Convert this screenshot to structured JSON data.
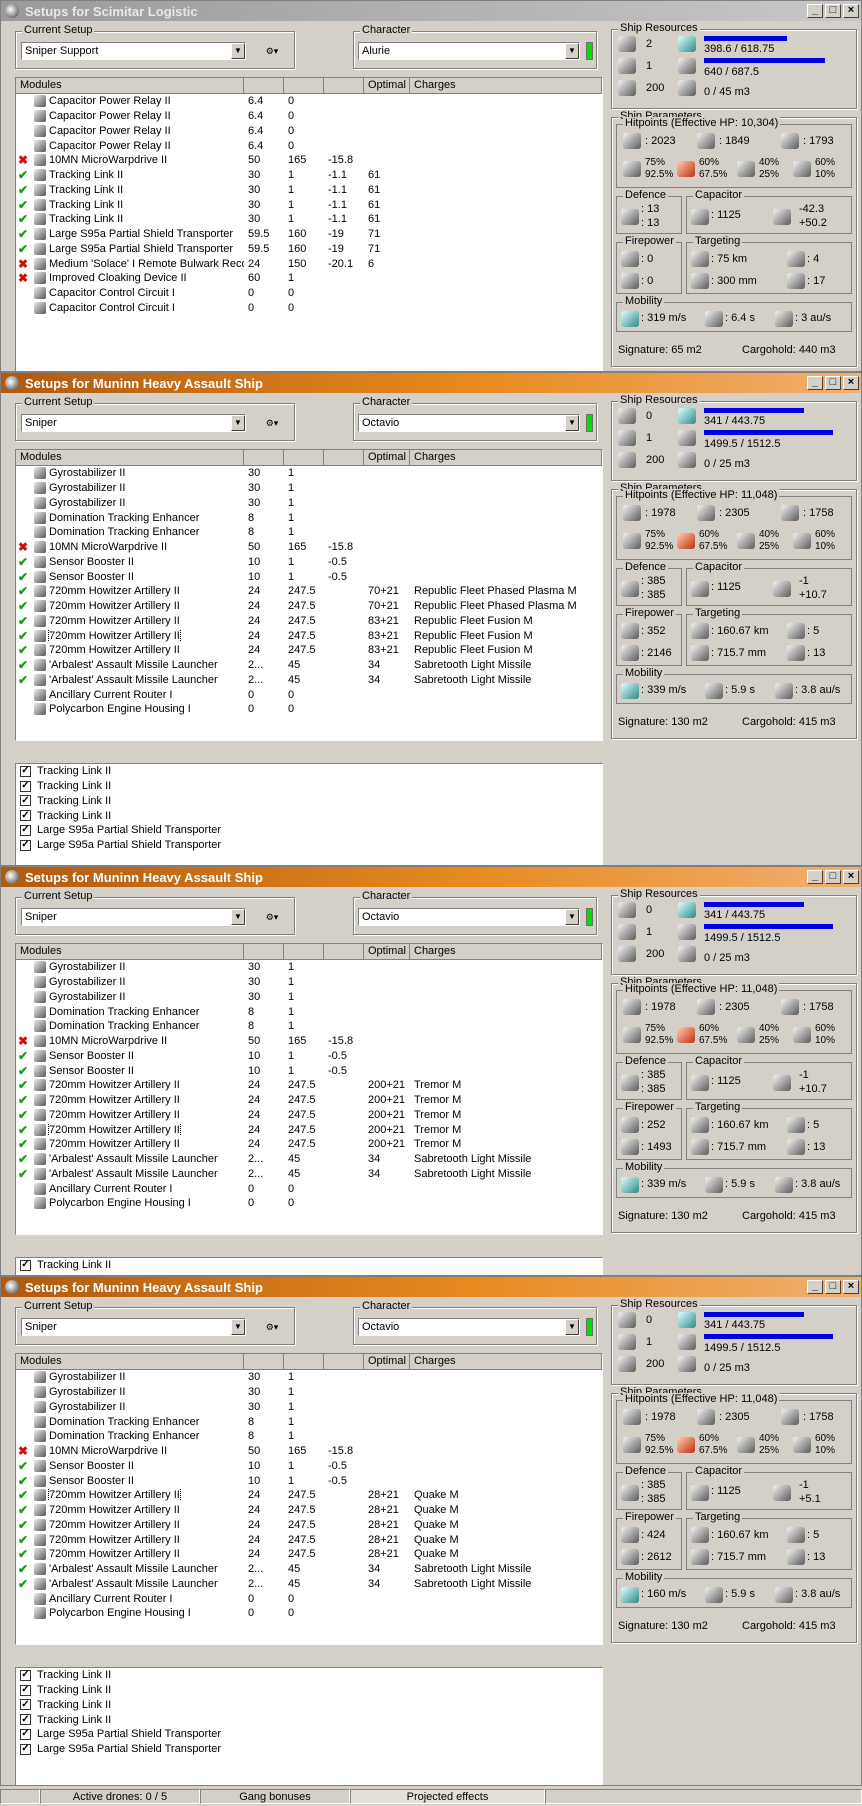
{
  "windows": [
    {
      "title": "Setups for Scimitar Logistic",
      "title_style": "inactive",
      "setup": "Sniper Support",
      "character": "Alurie",
      "headers": [
        "Modules",
        "",
        "",
        "",
        "Optimal",
        "Charges"
      ],
      "modules": [
        {
          "st": "",
          "name": "Capacitor Power Relay II",
          "c1": "6.4",
          "c2": "0",
          "c3": "",
          "opt": "",
          "chg": ""
        },
        {
          "st": "",
          "name": "Capacitor Power Relay II",
          "c1": "6.4",
          "c2": "0",
          "c3": "",
          "opt": "",
          "chg": ""
        },
        {
          "st": "",
          "name": "Capacitor Power Relay II",
          "c1": "6.4",
          "c2": "0",
          "c3": "",
          "opt": "",
          "chg": ""
        },
        {
          "st": "",
          "name": "Capacitor Power Relay II",
          "c1": "6.4",
          "c2": "0",
          "c3": "",
          "opt": "",
          "chg": ""
        },
        {
          "st": "x",
          "name": "10MN MicroWarpdrive II",
          "c1": "50",
          "c2": "165",
          "c3": "-15.8",
          "opt": "",
          "chg": ""
        },
        {
          "st": "v",
          "name": "Tracking Link II",
          "c1": "30",
          "c2": "1",
          "c3": "-1.1",
          "opt": "61",
          "chg": ""
        },
        {
          "st": "v",
          "name": "Tracking Link II",
          "c1": "30",
          "c2": "1",
          "c3": "-1.1",
          "opt": "61",
          "chg": ""
        },
        {
          "st": "v",
          "name": "Tracking Link II",
          "c1": "30",
          "c2": "1",
          "c3": "-1.1",
          "opt": "61",
          "chg": ""
        },
        {
          "st": "v",
          "name": "Tracking Link II",
          "c1": "30",
          "c2": "1",
          "c3": "-1.1",
          "opt": "61",
          "chg": ""
        },
        {
          "st": "v",
          "name": "Large S95a Partial Shield Transporter",
          "c1": "59.5",
          "c2": "160",
          "c3": "-19",
          "opt": "71",
          "chg": ""
        },
        {
          "st": "v",
          "name": "Large S95a Partial Shield Transporter",
          "c1": "59.5",
          "c2": "160",
          "c3": "-19",
          "opt": "71",
          "chg": ""
        },
        {
          "st": "x",
          "name": "Medium 'Solace' I Remote Bulwark Reco...",
          "c1": "24",
          "c2": "150",
          "c3": "-20.1",
          "opt": "6",
          "chg": ""
        },
        {
          "st": "x",
          "name": "Improved Cloaking Device II",
          "c1": "60",
          "c2": "1",
          "c3": "",
          "opt": "",
          "chg": ""
        },
        {
          "st": "",
          "name": "Capacitor Control Circuit I",
          "c1": "0",
          "c2": "0",
          "c3": "",
          "opt": "",
          "chg": ""
        },
        {
          "st": "",
          "name": "Capacitor Control Circuit I",
          "c1": "0",
          "c2": "0",
          "c3": "",
          "opt": "",
          "chg": ""
        }
      ],
      "projected": [],
      "res": {
        "hi": "2",
        "mid": "1",
        "drone": "200",
        "cpu": "398.6 / 618.75",
        "pg": "640 / 687.5",
        "db": "0 / 45 m3",
        "cpu_frac": 0.64,
        "pg_frac": 0.93,
        "db_frac": 0
      },
      "hp": {
        "header": "Hitpoints (Effective HP: 10,304)",
        "shield": ": 2023",
        "armor": ": 1849",
        "hull": ": 1793",
        "r1a": "75%",
        "r1b": "92.5%",
        "r2a": "60%",
        "r2b": "67.5%",
        "r3a": "40%",
        "r3b": "25%",
        "r4a": "60%",
        "r4b": "10%"
      },
      "def": {
        "a": ": 13",
        "b": ": 13"
      },
      "cap": {
        "a": ": 1125",
        "b": "-42.3",
        "c": "+50.2"
      },
      "fire": {
        "a": ": 0",
        "b": ": 0"
      },
      "tgt": {
        "a": ": 75 km",
        "b": ": 4",
        "c": ": 300 mm",
        "d": ": 17"
      },
      "mob": {
        "a": ": 319 m/s",
        "b": ": 6.4 s",
        "c": ": 3 au/s"
      },
      "sig": "Signature: 65 m2",
      "cargo": "Cargohold: 440 m3"
    },
    {
      "title": "Setups for Muninn Heavy Assault Ship",
      "title_style": "active",
      "setup": "Sniper",
      "character": "Octavio",
      "headers": [
        "Modules",
        "",
        "",
        "",
        "Optimal",
        "Charges"
      ],
      "modules": [
        {
          "st": "",
          "name": "Gyrostabilizer II",
          "c1": "30",
          "c2": "1",
          "c3": "",
          "opt": "",
          "chg": ""
        },
        {
          "st": "",
          "name": "Gyrostabilizer II",
          "c1": "30",
          "c2": "1",
          "c3": "",
          "opt": "",
          "chg": ""
        },
        {
          "st": "",
          "name": "Gyrostabilizer II",
          "c1": "30",
          "c2": "1",
          "c3": "",
          "opt": "",
          "chg": ""
        },
        {
          "st": "",
          "name": "Domination Tracking Enhancer",
          "c1": "8",
          "c2": "1",
          "c3": "",
          "opt": "",
          "chg": ""
        },
        {
          "st": "",
          "name": "Domination Tracking Enhancer",
          "c1": "8",
          "c2": "1",
          "c3": "",
          "opt": "",
          "chg": ""
        },
        {
          "st": "x",
          "name": "10MN MicroWarpdrive II",
          "c1": "50",
          "c2": "165",
          "c3": "-15.8",
          "opt": "",
          "chg": ""
        },
        {
          "st": "v",
          "name": "Sensor Booster II",
          "c1": "10",
          "c2": "1",
          "c3": "-0.5",
          "opt": "",
          "chg": ""
        },
        {
          "st": "v",
          "name": "Sensor Booster II",
          "c1": "10",
          "c2": "1",
          "c3": "-0.5",
          "opt": "",
          "chg": ""
        },
        {
          "st": "v",
          "name": "720mm Howitzer Artillery II",
          "c1": "24",
          "c2": "247.5",
          "c3": "",
          "opt": "70+21",
          "chg": "Republic Fleet Phased Plasma M"
        },
        {
          "st": "v",
          "name": "720mm Howitzer Artillery II",
          "c1": "24",
          "c2": "247.5",
          "c3": "",
          "opt": "70+21",
          "chg": "Republic Fleet Phased Plasma M"
        },
        {
          "st": "v",
          "name": "720mm Howitzer Artillery II",
          "c1": "24",
          "c2": "247.5",
          "c3": "",
          "opt": "83+21",
          "chg": "Republic Fleet Fusion M"
        },
        {
          "st": "v",
          "name": "720mm Howitzer Artillery II",
          "c1": "24",
          "c2": "247.5",
          "c3": "",
          "opt": "83+21",
          "chg": "Republic Fleet Fusion M",
          "sel": true
        },
        {
          "st": "v",
          "name": "720mm Howitzer Artillery II",
          "c1": "24",
          "c2": "247.5",
          "c3": "",
          "opt": "83+21",
          "chg": "Republic Fleet Fusion M"
        },
        {
          "st": "v",
          "name": "'Arbalest' Assault Missile Launcher",
          "c1": "2...",
          "c2": "45",
          "c3": "",
          "opt": "34",
          "chg": "Sabretooth Light Missile"
        },
        {
          "st": "v",
          "name": "'Arbalest' Assault Missile Launcher",
          "c1": "2...",
          "c2": "45",
          "c3": "",
          "opt": "34",
          "chg": "Sabretooth Light Missile"
        },
        {
          "st": "",
          "name": "Ancillary Current Router I",
          "c1": "0",
          "c2": "0",
          "c3": "",
          "opt": "",
          "chg": ""
        },
        {
          "st": "",
          "name": "Polycarbon Engine Housing I",
          "c1": "0",
          "c2": "0",
          "c3": "",
          "opt": "",
          "chg": ""
        }
      ],
      "projected": [
        "Tracking Link II",
        "Tracking Link II",
        "Tracking Link II",
        "Tracking Link II",
        "Large S95a Partial Shield Transporter",
        "Large S95a Partial Shield Transporter"
      ],
      "res": {
        "hi": "0",
        "mid": "1",
        "drone": "200",
        "cpu": "341 / 443.75",
        "pg": "1499.5 / 1512.5",
        "db": "0 / 25 m3",
        "cpu_frac": 0.77,
        "pg_frac": 0.99,
        "db_frac": 0
      },
      "hp": {
        "header": "Hitpoints (Effective HP: 11,048)",
        "shield": ": 1978",
        "armor": ": 2305",
        "hull": ": 1758",
        "r1a": "75%",
        "r1b": "92.5%",
        "r2a": "60%",
        "r2b": "67.5%",
        "r3a": "40%",
        "r3b": "25%",
        "r4a": "60%",
        "r4b": "10%"
      },
      "def": {
        "a": ": 385",
        "b": ": 385"
      },
      "cap": {
        "a": ": 1125",
        "b": "-1",
        "c": "+10.7"
      },
      "fire": {
        "a": ": 352",
        "b": ": 2146"
      },
      "tgt": {
        "a": ": 160.67 km",
        "b": ": 5",
        "c": ": 715.7 mm",
        "d": ": 13"
      },
      "mob": {
        "a": ": 339 m/s",
        "b": ": 5.9 s",
        "c": ": 3.8 au/s"
      },
      "sig": "Signature: 130 m2",
      "cargo": "Cargohold: 415 m3"
    },
    {
      "title": "Setups for Muninn Heavy Assault Ship",
      "title_style": "active",
      "setup": "Sniper",
      "character": "Octavio",
      "headers": [
        "Modules",
        "",
        "",
        "",
        "Optimal",
        "Charges"
      ],
      "modules": [
        {
          "st": "",
          "name": "Gyrostabilizer II",
          "c1": "30",
          "c2": "1",
          "c3": "",
          "opt": "",
          "chg": ""
        },
        {
          "st": "",
          "name": "Gyrostabilizer II",
          "c1": "30",
          "c2": "1",
          "c3": "",
          "opt": "",
          "chg": ""
        },
        {
          "st": "",
          "name": "Gyrostabilizer II",
          "c1": "30",
          "c2": "1",
          "c3": "",
          "opt": "",
          "chg": ""
        },
        {
          "st": "",
          "name": "Domination Tracking Enhancer",
          "c1": "8",
          "c2": "1",
          "c3": "",
          "opt": "",
          "chg": ""
        },
        {
          "st": "",
          "name": "Domination Tracking Enhancer",
          "c1": "8",
          "c2": "1",
          "c3": "",
          "opt": "",
          "chg": ""
        },
        {
          "st": "x",
          "name": "10MN MicroWarpdrive II",
          "c1": "50",
          "c2": "165",
          "c3": "-15.8",
          "opt": "",
          "chg": ""
        },
        {
          "st": "v",
          "name": "Sensor Booster II",
          "c1": "10",
          "c2": "1",
          "c3": "-0.5",
          "opt": "",
          "chg": ""
        },
        {
          "st": "v",
          "name": "Sensor Booster II",
          "c1": "10",
          "c2": "1",
          "c3": "-0.5",
          "opt": "",
          "chg": ""
        },
        {
          "st": "v",
          "name": "720mm Howitzer Artillery II",
          "c1": "24",
          "c2": "247.5",
          "c3": "",
          "opt": "200+21",
          "chg": "Tremor M"
        },
        {
          "st": "v",
          "name": "720mm Howitzer Artillery II",
          "c1": "24",
          "c2": "247.5",
          "c3": "",
          "opt": "200+21",
          "chg": "Tremor M"
        },
        {
          "st": "v",
          "name": "720mm Howitzer Artillery II",
          "c1": "24",
          "c2": "247.5",
          "c3": "",
          "opt": "200+21",
          "chg": "Tremor M"
        },
        {
          "st": "v",
          "name": "720mm Howitzer Artillery II",
          "c1": "24",
          "c2": "247.5",
          "c3": "",
          "opt": "200+21",
          "chg": "Tremor M",
          "sel": true
        },
        {
          "st": "v",
          "name": "720mm Howitzer Artillery II",
          "c1": "24",
          "c2": "247.5",
          "c3": "",
          "opt": "200+21",
          "chg": "Tremor M"
        },
        {
          "st": "v",
          "name": "'Arbalest' Assault Missile Launcher",
          "c1": "2...",
          "c2": "45",
          "c3": "",
          "opt": "34",
          "chg": "Sabretooth Light Missile"
        },
        {
          "st": "v",
          "name": "'Arbalest' Assault Missile Launcher",
          "c1": "2...",
          "c2": "45",
          "c3": "",
          "opt": "34",
          "chg": "Sabretooth Light Missile"
        },
        {
          "st": "",
          "name": "Ancillary Current Router I",
          "c1": "0",
          "c2": "0",
          "c3": "",
          "opt": "",
          "chg": ""
        },
        {
          "st": "",
          "name": "Polycarbon Engine Housing I",
          "c1": "0",
          "c2": "0",
          "c3": "",
          "opt": "",
          "chg": ""
        }
      ],
      "projected": [
        "Tracking Link II"
      ],
      "res": {
        "hi": "0",
        "mid": "1",
        "drone": "200",
        "cpu": "341 / 443.75",
        "pg": "1499.5 / 1512.5",
        "db": "0 / 25 m3",
        "cpu_frac": 0.77,
        "pg_frac": 0.99,
        "db_frac": 0
      },
      "hp": {
        "header": "Hitpoints (Effective HP: 11,048)",
        "shield": ": 1978",
        "armor": ": 2305",
        "hull": ": 1758",
        "r1a": "75%",
        "r1b": "92.5%",
        "r2a": "60%",
        "r2b": "67.5%",
        "r3a": "40%",
        "r3b": "25%",
        "r4a": "60%",
        "r4b": "10%"
      },
      "def": {
        "a": ": 385",
        "b": ": 385"
      },
      "cap": {
        "a": ": 1125",
        "b": "-1",
        "c": "+10.7"
      },
      "fire": {
        "a": ": 252",
        "b": ": 1493"
      },
      "tgt": {
        "a": ": 160.67 km",
        "b": ": 5",
        "c": ": 715.7 mm",
        "d": ": 13"
      },
      "mob": {
        "a": ": 339 m/s",
        "b": ": 5.9 s",
        "c": ": 3.8 au/s"
      },
      "sig": "Signature: 130 m2",
      "cargo": "Cargohold: 415 m3"
    },
    {
      "title": "Setups for Muninn Heavy Assault Ship",
      "title_style": "active",
      "setup": "Sniper",
      "character": "Octavio",
      "headers": [
        "Modules",
        "",
        "",
        "",
        "Optimal",
        "Charges"
      ],
      "modules": [
        {
          "st": "",
          "name": "Gyrostabilizer II",
          "c1": "30",
          "c2": "1",
          "c3": "",
          "opt": "",
          "chg": ""
        },
        {
          "st": "",
          "name": "Gyrostabilizer II",
          "c1": "30",
          "c2": "1",
          "c3": "",
          "opt": "",
          "chg": ""
        },
        {
          "st": "",
          "name": "Gyrostabilizer II",
          "c1": "30",
          "c2": "1",
          "c3": "",
          "opt": "",
          "chg": ""
        },
        {
          "st": "",
          "name": "Domination Tracking Enhancer",
          "c1": "8",
          "c2": "1",
          "c3": "",
          "opt": "",
          "chg": ""
        },
        {
          "st": "",
          "name": "Domination Tracking Enhancer",
          "c1": "8",
          "c2": "1",
          "c3": "",
          "opt": "",
          "chg": ""
        },
        {
          "st": "x",
          "name": "10MN MicroWarpdrive II",
          "c1": "50",
          "c2": "165",
          "c3": "-15.8",
          "opt": "",
          "chg": ""
        },
        {
          "st": "v",
          "name": "Sensor Booster II",
          "c1": "10",
          "c2": "1",
          "c3": "-0.5",
          "opt": "",
          "chg": ""
        },
        {
          "st": "v",
          "name": "Sensor Booster II",
          "c1": "10",
          "c2": "1",
          "c3": "-0.5",
          "opt": "",
          "chg": ""
        },
        {
          "st": "v",
          "name": "720mm Howitzer Artillery II",
          "c1": "24",
          "c2": "247.5",
          "c3": "",
          "opt": "28+21",
          "chg": "Quake M",
          "sel": true
        },
        {
          "st": "v",
          "name": "720mm Howitzer Artillery II",
          "c1": "24",
          "c2": "247.5",
          "c3": "",
          "opt": "28+21",
          "chg": "Quake M"
        },
        {
          "st": "v",
          "name": "720mm Howitzer Artillery II",
          "c1": "24",
          "c2": "247.5",
          "c3": "",
          "opt": "28+21",
          "chg": "Quake M"
        },
        {
          "st": "v",
          "name": "720mm Howitzer Artillery II",
          "c1": "24",
          "c2": "247.5",
          "c3": "",
          "opt": "28+21",
          "chg": "Quake M"
        },
        {
          "st": "v",
          "name": "720mm Howitzer Artillery II",
          "c1": "24",
          "c2": "247.5",
          "c3": "",
          "opt": "28+21",
          "chg": "Quake M"
        },
        {
          "st": "v",
          "name": "'Arbalest' Assault Missile Launcher",
          "c1": "2...",
          "c2": "45",
          "c3": "",
          "opt": "34",
          "chg": "Sabretooth Light Missile"
        },
        {
          "st": "v",
          "name": "'Arbalest' Assault Missile Launcher",
          "c1": "2...",
          "c2": "45",
          "c3": "",
          "opt": "34",
          "chg": "Sabretooth Light Missile"
        },
        {
          "st": "",
          "name": "Ancillary Current Router I",
          "c1": "0",
          "c2": "0",
          "c3": "",
          "opt": "",
          "chg": ""
        },
        {
          "st": "",
          "name": "Polycarbon Engine Housing I",
          "c1": "0",
          "c2": "0",
          "c3": "",
          "opt": "",
          "chg": ""
        }
      ],
      "projected": [
        "Tracking Link II",
        "Tracking Link II",
        "Tracking Link II",
        "Tracking Link II",
        "Large S95a Partial Shield Transporter",
        "Large S95a Partial Shield Transporter"
      ],
      "res": {
        "hi": "0",
        "mid": "1",
        "drone": "200",
        "cpu": "341 / 443.75",
        "pg": "1499.5 / 1512.5",
        "db": "0 / 25 m3",
        "cpu_frac": 0.77,
        "pg_frac": 0.99,
        "db_frac": 0
      },
      "hp": {
        "header": "Hitpoints (Effective HP: 11,048)",
        "shield": ": 1978",
        "armor": ": 2305",
        "hull": ": 1758",
        "r1a": "75%",
        "r1b": "92.5%",
        "r2a": "60%",
        "r2b": "67.5%",
        "r3a": "40%",
        "r3b": "25%",
        "r4a": "60%",
        "r4b": "10%"
      },
      "def": {
        "a": ": 385",
        "b": ": 385"
      },
      "cap": {
        "a": ": 1125",
        "b": "-1",
        "c": "+5.1"
      },
      "fire": {
        "a": ": 424",
        "b": ": 2612"
      },
      "tgt": {
        "a": ": 160.67 km",
        "b": ": 5",
        "c": ": 715.7 mm",
        "d": ": 13"
      },
      "mob": {
        "a": ": 160 m/s",
        "b": ": 5.9 s",
        "c": ": 3.8 au/s"
      },
      "sig": "Signature: 130 m2",
      "cargo": "Cargohold: 415 m3"
    }
  ],
  "labels": {
    "current_setup": "Current Setup",
    "character": "Character",
    "ship_resources": "Ship Resources",
    "ship_parameters": "Ship Parameters",
    "defence": "Defence",
    "capacitor": "Capacitor",
    "firepower": "Firepower",
    "targeting": "Targeting",
    "mobility": "Mobility"
  },
  "status": {
    "drones": "Active drones: 0 / 5",
    "gang": "Gang bonuses",
    "projected": "Projected effects"
  }
}
